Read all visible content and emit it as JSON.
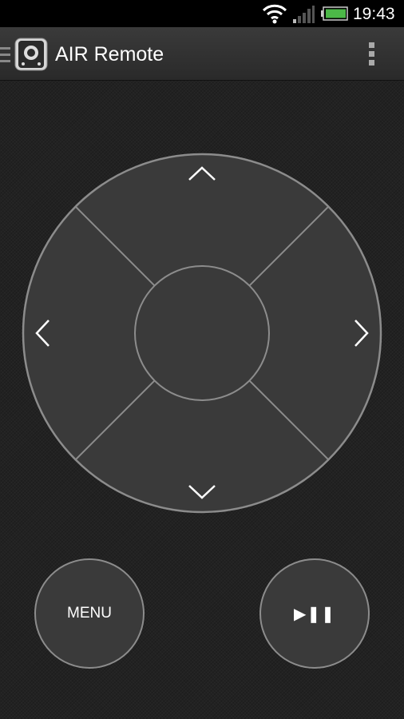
{
  "status_bar": {
    "time": "19:43"
  },
  "app_bar": {
    "title": "AIR Remote"
  },
  "remote": {
    "menu_label": "MENU",
    "play_pause_label": "▶❚❚"
  }
}
